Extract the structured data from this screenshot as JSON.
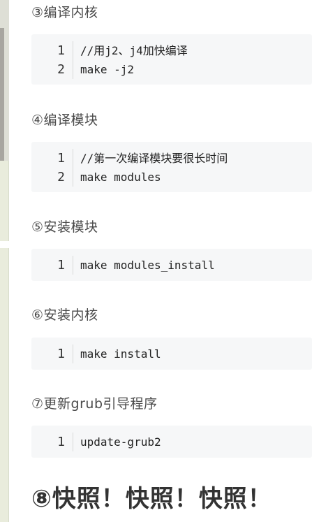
{
  "sections": [
    {
      "heading": "③编译内核",
      "lines": [
        {
          "num": "1",
          "text": "//用j2、j4加快编译"
        },
        {
          "num": "2",
          "text": "make -j2"
        }
      ]
    },
    {
      "heading": "④编译模块",
      "lines": [
        {
          "num": "1",
          "text": "//第一次编译模块要很长时间"
        },
        {
          "num": "2",
          "text": "make modules"
        }
      ]
    },
    {
      "heading": "⑤安装模块",
      "lines": [
        {
          "num": "1",
          "text": "make modules_install"
        }
      ]
    },
    {
      "heading": "⑥安装内核",
      "lines": [
        {
          "num": "1",
          "text": "make install"
        }
      ]
    },
    {
      "heading": "⑦更新grub引导程序",
      "lines": [
        {
          "num": "1",
          "text": "update-grub2"
        }
      ]
    }
  ],
  "final_heading": "⑧快照！快照！快照！"
}
